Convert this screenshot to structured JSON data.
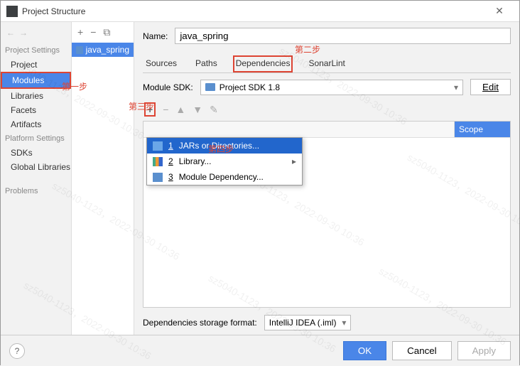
{
  "title": "Project Structure",
  "left": {
    "projectSettingsHeader": "Project Settings",
    "items": [
      "Project",
      "Modules",
      "Libraries",
      "Facets",
      "Artifacts"
    ],
    "platformHeader": "Platform Settings",
    "platformItems": [
      "SDKs",
      "Global Libraries"
    ],
    "problems": "Problems"
  },
  "module": {
    "name": "java_spring"
  },
  "nameLabel": "Name:",
  "nameValue": "java_spring",
  "tabs": [
    "Sources",
    "Paths",
    "Dependencies",
    "SonarLint"
  ],
  "sdkLabel": "Module SDK:",
  "sdkValue": "Project SDK 1.8",
  "editLabel": "Edit",
  "scopeHeader": "Scope",
  "popup": {
    "i1": "JARs or Directories...",
    "i2": "Library...",
    "i3": "Module Dependency..."
  },
  "storageLabel": "Dependencies storage format:",
  "storageValue": "IntelliJ IDEA (.iml)",
  "footer": {
    "ok": "OK",
    "cancel": "Cancel",
    "apply": "Apply"
  },
  "annotations": {
    "a1": "第一步",
    "a2": "第二步",
    "a3": "第三步",
    "a4": "第四步"
  },
  "watermark": "sz5040-1123，2022-09-30 10:36"
}
